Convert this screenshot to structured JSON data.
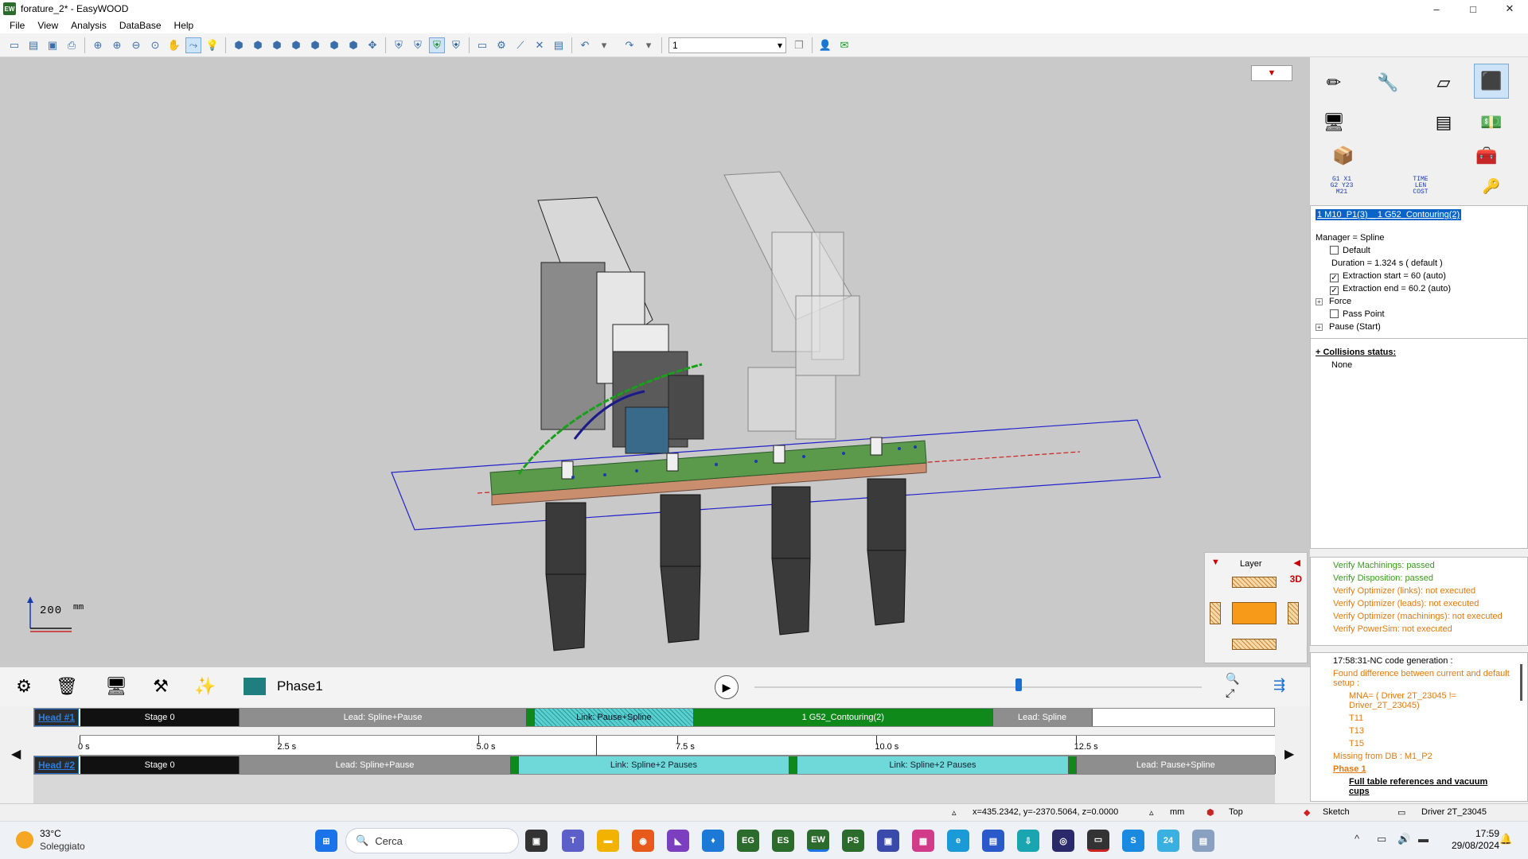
{
  "window": {
    "title": "forature_2* - EasyWOOD",
    "app_badge": "EW",
    "minimize": "–",
    "maximize": "□",
    "close": "✕"
  },
  "menu": [
    "File",
    "View",
    "Analysis",
    "DataBase",
    "Help"
  ],
  "toolbar": {
    "combo_value": "1",
    "combo_arrow": "▾"
  },
  "viewport": {
    "dropdown_glyph": "▼",
    "scale_value": "200",
    "scale_unit": "mm"
  },
  "layer_panel": {
    "title": "Layer",
    "mode": "3D"
  },
  "right_panel": {
    "time_label": "TIME\nLEN\nCOST",
    "gcode_label": "G1 X1\nG2 Y23\nM21",
    "selected_item": "1 M10_P1(3) _ 1 G52_Contouring(2)",
    "props": [
      {
        "text": "Manager = Spline",
        "kind": "text"
      },
      {
        "text": "Default",
        "kind": "checkbox",
        "checked": false
      },
      {
        "text": "Duration = 1.324 s ( default )",
        "kind": "text-indent"
      },
      {
        "text": "Extraction start = 60 (auto)",
        "kind": "checkbox",
        "checked": true
      },
      {
        "text": "Extraction end = 60.2 (auto)",
        "kind": "checkbox",
        "checked": true
      },
      {
        "text": "Force",
        "kind": "expand"
      },
      {
        "text": "Pass Point",
        "kind": "checkbox",
        "checked": false
      },
      {
        "text": "Pause (Start)",
        "kind": "expand"
      }
    ],
    "collisions_title": "+ Collisions status:",
    "collisions_value": "None",
    "verify": [
      {
        "text": "Verify Machinings: passed",
        "color": "#3a9a1e"
      },
      {
        "text": "Verify Disposition: passed",
        "color": "#3a9a1e"
      },
      {
        "text": "Verify Optimizer (links): not executed",
        "color": "#e07a10"
      },
      {
        "text": "Verify Optimizer (leads): not executed",
        "color": "#e07a10"
      },
      {
        "text": "Verify Optimizer (machinings): not executed",
        "color": "#e07a10"
      },
      {
        "text": "Verify PowerSim: not executed",
        "color": "#e07a10"
      }
    ],
    "nc": {
      "header": "17:58:31-NC code generation :",
      "diff1": "Found difference between current and default",
      "diff2": "setup :",
      "mna1": "MNA= ( Driver 2T_23045 !=",
      "mna2": "Driver_2T_23045)",
      "t1": "T11",
      "t2": "T13",
      "t3": "T15",
      "missing": "Missing from DB : M1_P2",
      "phase": "Phase 1",
      "full1": "Full table references and vacuum",
      "full2": "cups"
    }
  },
  "timeline": {
    "phase": "Phase1",
    "head1": {
      "name": "Head #1",
      "segments": [
        {
          "label": "Stage 0",
          "start": 0,
          "end": 2.0,
          "style": "black"
        },
        {
          "label": "Lead: Spline+Pause",
          "start": 2.0,
          "end": 5.6,
          "style": "gray"
        },
        {
          "label": "",
          "start": 5.6,
          "end": 5.7,
          "style": "green"
        },
        {
          "label": "Link: Pause+Spline",
          "start": 5.7,
          "end": 7.7,
          "style": "cyanhatch"
        },
        {
          "label": "1 G52_Contouring(2)",
          "start": 7.7,
          "end": 11.45,
          "style": "green"
        },
        {
          "label": "Lead: Spline",
          "start": 11.45,
          "end": 12.7,
          "style": "gray"
        }
      ]
    },
    "head2": {
      "name": "Head #2",
      "segments": [
        {
          "label": "Stage 0",
          "start": 0,
          "end": 2.0,
          "style": "black"
        },
        {
          "label": "Lead: Spline+Pause",
          "start": 2.0,
          "end": 5.4,
          "style": "gray"
        },
        {
          "label": "",
          "start": 5.4,
          "end": 5.5,
          "style": "green"
        },
        {
          "label": "Link: Spline+2 Pauses",
          "start": 5.5,
          "end": 8.9,
          "style": "cyan"
        },
        {
          "label": "",
          "start": 8.9,
          "end": 9.0,
          "style": "green"
        },
        {
          "label": "Link: Spline+2 Pauses",
          "start": 9.0,
          "end": 12.4,
          "style": "cyan"
        },
        {
          "label": "",
          "start": 12.4,
          "end": 12.5,
          "style": "green"
        },
        {
          "label": "Lead: Pause+Spline",
          "start": 12.5,
          "end": 15.0,
          "style": "gray"
        }
      ]
    },
    "ticks": [
      "0 s",
      "2.5 s",
      "5.0 s",
      "7.5 s",
      "10.0 s",
      "12.5 s"
    ],
    "tick_values": [
      0,
      2.5,
      5.0,
      7.5,
      10.0,
      12.5
    ],
    "range_max": 15.0,
    "playhead_value": 0.59
  },
  "status": {
    "coords": "x=435.2342, y=-2370.5064, z=0.0000",
    "unit": "mm",
    "view": "Top",
    "mode": "Sketch",
    "driver": "Driver 2T_23045"
  },
  "taskbar": {
    "temp": "33°C",
    "condition": "Soleggiato",
    "search": "Cerca",
    "time": "17:59",
    "date": "29/08/2024"
  }
}
